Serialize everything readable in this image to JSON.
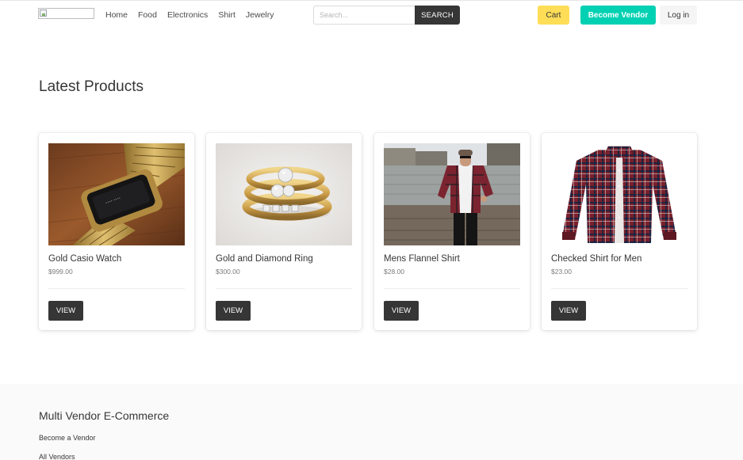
{
  "navbar": {
    "logo_alt": "",
    "links": [
      "Home",
      "Food",
      "Electronics",
      "Shirt",
      "Jewelry"
    ],
    "search": {
      "placeholder": "Search...",
      "button_label": "SEARCH"
    },
    "cart_label": "Cart",
    "become_vendor_label": "Become Vendor",
    "login_label": "Log in"
  },
  "main": {
    "title": "Latest Products",
    "products": [
      {
        "name": "Gold Casio Watch",
        "price": "$999.00",
        "button_label": "VIEW",
        "image": "gold-watch-image"
      },
      {
        "name": "Gold and Diamond Ring",
        "price": "$300.00",
        "button_label": "VIEW",
        "image": "diamond-rings-image"
      },
      {
        "name": "Mens Flannel Shirt",
        "price": "$28.00",
        "button_label": "VIEW",
        "image": "man-flannel-shirt-image"
      },
      {
        "name": "Checked Shirt for Men",
        "price": "$23.00",
        "button_label": "VIEW",
        "image": "checked-shirt-image"
      }
    ]
  },
  "footer": {
    "title": "Multi Vendor E-Commerce",
    "links": [
      "Become a Vendor",
      "All Vendors"
    ]
  },
  "colors": {
    "dark": "#363636",
    "cart": "#ffdd57",
    "vendor": "#00d1b2",
    "login": "#f5f5f5",
    "footer_bg": "#fafafa"
  }
}
